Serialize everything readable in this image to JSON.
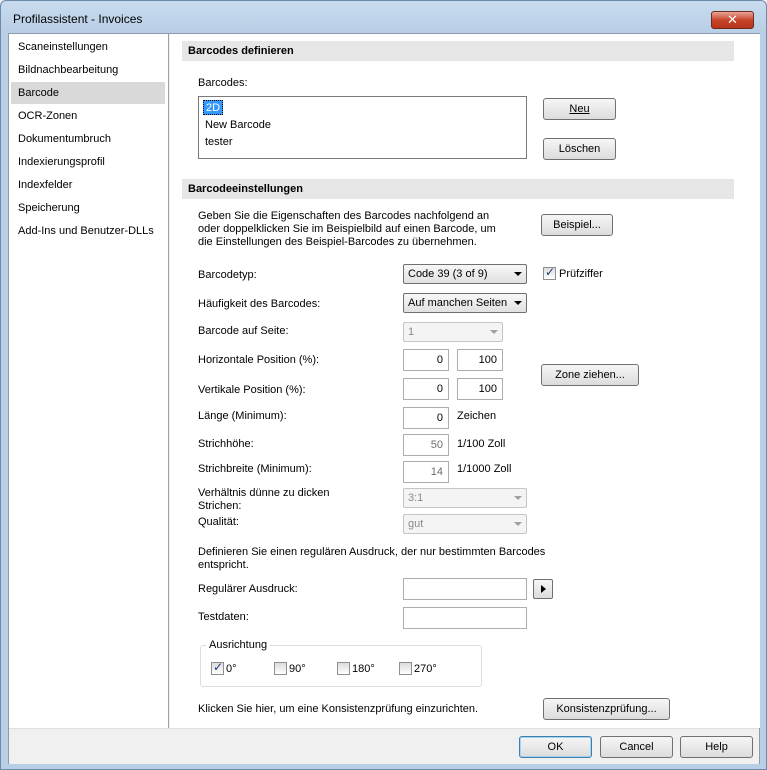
{
  "window": {
    "title": "Profilassistent - Invoices",
    "close_label": "✕"
  },
  "sidebar": {
    "items": [
      {
        "label": "Scaneinstellungen"
      },
      {
        "label": "Bildnachbearbeitung"
      },
      {
        "label": "Barcode"
      },
      {
        "label": "OCR-Zonen"
      },
      {
        "label": "Dokumentumbruch"
      },
      {
        "label": "Indexierungsprofil"
      },
      {
        "label": "Indexfelder"
      },
      {
        "label": "Speicherung"
      },
      {
        "label": "Add-Ins und Benutzer-DLLs"
      }
    ],
    "selected": "Barcode"
  },
  "define": {
    "header": "Barcodes definieren",
    "list_label": "Barcodes:",
    "items": [
      "2D",
      "New Barcode",
      "tester"
    ],
    "new_button": "Neu",
    "delete_button": "Löschen"
  },
  "settings": {
    "header": "Barcodeeinstellungen",
    "description": [
      "Geben Sie die Eigenschaften des Barcodes nachfolgend an",
      "oder doppelklicken Sie im Beispielbild auf einen Barcode, um",
      "die Einstellungen des Beispiel-Barcodes zu übernehmen."
    ],
    "example_button": "Beispiel...",
    "type_label": "Barcodetyp:",
    "type_value": "Code 39 (3 of 9)",
    "checksum_label": "Prüfziffer",
    "checksum_checked": true,
    "frequency_label": "Häufigkeit des Barcodes:",
    "frequency_value": "Auf manchen Seiten",
    "page_label": "Barcode auf Seite:",
    "page_value": "1",
    "hpos_label": "Horizontale Position (%):",
    "hpos_from": "0",
    "hpos_to": "100",
    "vpos_label": "Vertikale Position (%):",
    "vpos_from": "0",
    "vpos_to": "100",
    "zone_button": "Zone ziehen...",
    "length_label": "Länge (Minimum):",
    "length_value": "0",
    "length_unit": "Zeichen",
    "height_label": "Strichhöhe:",
    "height_value": "50",
    "height_unit": "1/100 Zoll",
    "width_label": "Strichbreite (Minimum):",
    "width_value": "14",
    "width_unit": "1/1000 Zoll",
    "ratio_label_1": "Verhältnis dünne zu dicken",
    "ratio_label_2": "Strichen:",
    "ratio_value": "3:1",
    "quality_label": "Qualität:",
    "quality_value": "gut",
    "regex_description_1": "Definieren Sie einen regulären Ausdruck, der nur bestimmten Barcodes",
    "regex_description_2": "entspricht.",
    "regex_label": "Regulärer Ausdruck:",
    "regex_value": "",
    "testdata_label": "Testdaten:",
    "testdata_value": "",
    "orientation_title": "Ausrichtung",
    "orientations": [
      {
        "label": "0°",
        "checked": true
      },
      {
        "label": "90°",
        "checked": false
      },
      {
        "label": "180°",
        "checked": false
      },
      {
        "label": "270°",
        "checked": false
      }
    ],
    "consistency_text": "Klicken Sie hier, um eine Konsistenzprüfung einzurichten.",
    "consistency_button": "Konsistenzprüfung..."
  },
  "footer": {
    "ok": "OK",
    "cancel": "Cancel",
    "help": "Help"
  }
}
